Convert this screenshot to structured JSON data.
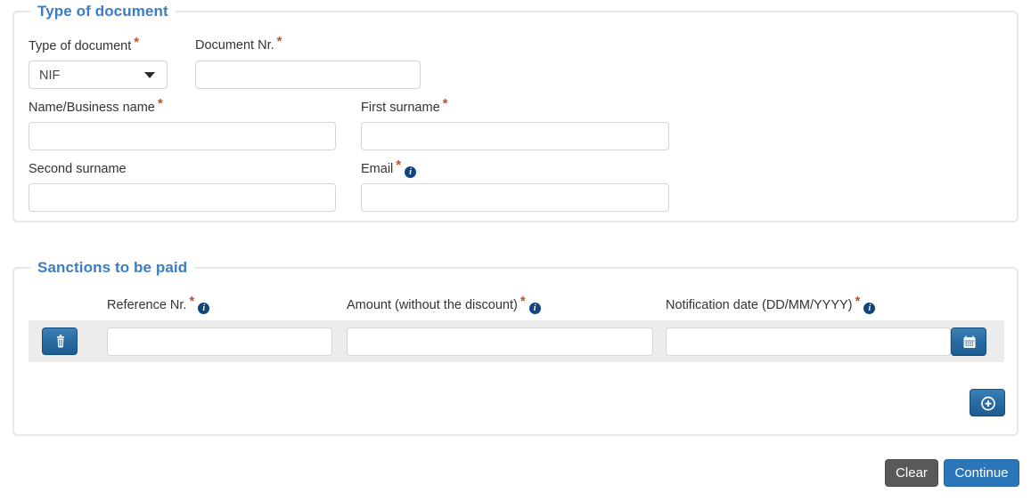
{
  "sections": {
    "document": {
      "legend": "Type of document",
      "fields": {
        "doc_type": {
          "label": "Type of document",
          "required": true,
          "value": "NIF"
        },
        "doc_number": {
          "label": "Document Nr.",
          "required": true,
          "value": ""
        },
        "name": {
          "label": "Name/Business name",
          "required": true,
          "value": ""
        },
        "first_surname": {
          "label": "First surname",
          "required": true,
          "value": ""
        },
        "second_surname": {
          "label": "Second surname",
          "required": false,
          "value": ""
        },
        "email": {
          "label": "Email",
          "required": true,
          "value": "",
          "info": true
        }
      }
    },
    "sanctions": {
      "legend": "Sanctions to be paid",
      "columns": [
        {
          "label": "Reference Nr.",
          "required": true,
          "info": true
        },
        {
          "label": "Amount (without the discount)",
          "required": true,
          "info": true
        },
        {
          "label": "Notification date (DD/MM/YYYY)",
          "required": true,
          "info": true
        }
      ],
      "rows": [
        {
          "reference": "",
          "amount": "",
          "notification_date": ""
        }
      ],
      "delete_icon": "trash-icon",
      "calendar_icon": "calendar-icon",
      "add_icon": "plus-circle-icon"
    }
  },
  "footer": {
    "clear_label": "Clear",
    "continue_label": "Continue"
  },
  "colors": {
    "legend_blue": "#3b7dc0",
    "required_orange": "#c0502a",
    "info_blue": "#10457e",
    "button_blue": "#2b76b9",
    "button_gray": "#595959",
    "row_band": "#ececec",
    "fieldset_border": "#e7e7e7"
  }
}
